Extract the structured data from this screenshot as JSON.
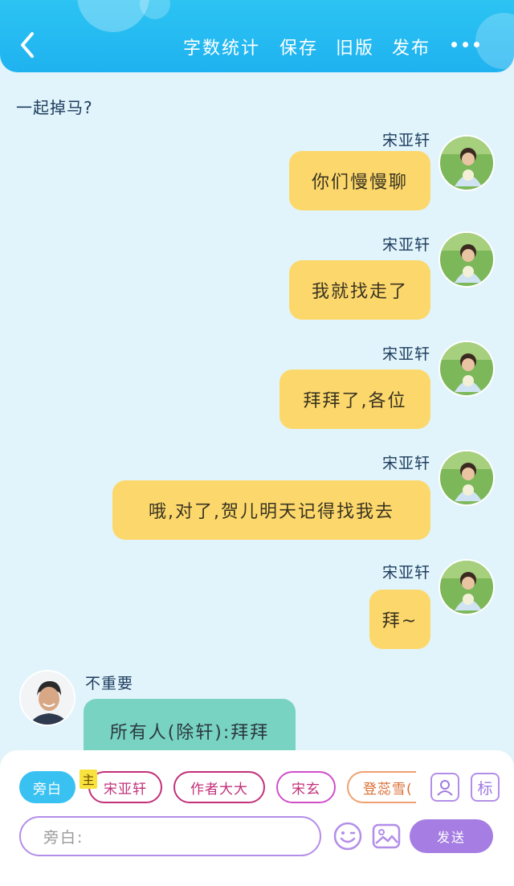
{
  "header": {
    "back_icon": "chevron-left-icon",
    "actions": [
      "字数统计",
      "保存",
      "旧版",
      "发布"
    ],
    "more_icon": "more-dots-icon"
  },
  "chat": {
    "system_line": "一起掉马?",
    "messages": [
      {
        "side": "right",
        "sender": "宋亚轩",
        "text": "你们慢慢聊"
      },
      {
        "side": "right",
        "sender": "宋亚轩",
        "text": "我就找走了"
      },
      {
        "side": "right",
        "sender": "宋亚轩",
        "text": "拜拜了,各位"
      },
      {
        "side": "right",
        "sender": "宋亚轩",
        "text": "哦,对了,贺儿明天记得找我去"
      },
      {
        "side": "right",
        "sender": "宋亚轩",
        "text": "拜~"
      },
      {
        "side": "left",
        "sender": "不重要",
        "text": "所有人(除轩):拜拜"
      }
    ]
  },
  "panel": {
    "roles": [
      "旁白",
      "宋亚轩",
      "作者大大",
      "宋玄",
      "登蕊雪("
    ],
    "main_badge": "主",
    "tag_label": "标",
    "input_placeholder": "旁白:",
    "send_label": "发送",
    "icons": [
      "user-card-icon",
      "tag-icon",
      "emoji-icon",
      "image-icon"
    ]
  },
  "colors": {
    "header": "#1fb2f0",
    "background": "#e1f4fb",
    "right_bubble": "#fcd86c",
    "left_bubble": "#79d3c2",
    "send_button": "#a57de3",
    "narration_tab": "#39c1f2"
  }
}
